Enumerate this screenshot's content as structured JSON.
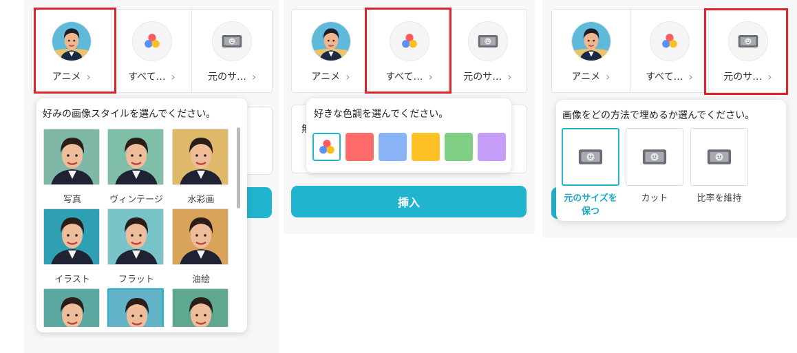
{
  "tabs": {
    "anime": "アニメ",
    "all_colors": "すべて…",
    "original_size": "元のサ…",
    "chevron": "›"
  },
  "panel1": {
    "title": "好みの画像スタイルを選んでください。",
    "styles": [
      "写真",
      "ヴィンテージ",
      "水彩画",
      "イラスト",
      "フラット",
      "油絵"
    ]
  },
  "panel2": {
    "title": "好きな色調を選んでください。",
    "behind_label": "無",
    "insert_label": "挿入",
    "swatch_colors": [
      "#ff6b6b",
      "#8ab4f8",
      "#ffc226",
      "#7fcf85",
      "#c59cf8"
    ]
  },
  "panel3": {
    "title": "画像をどの方法で埋めるか選んでください。",
    "options": [
      "元のサイズを保つ",
      "カット",
      "比率を維持"
    ]
  },
  "colors": {
    "accent": "#21b4cf",
    "highlight": "#e0222a"
  }
}
